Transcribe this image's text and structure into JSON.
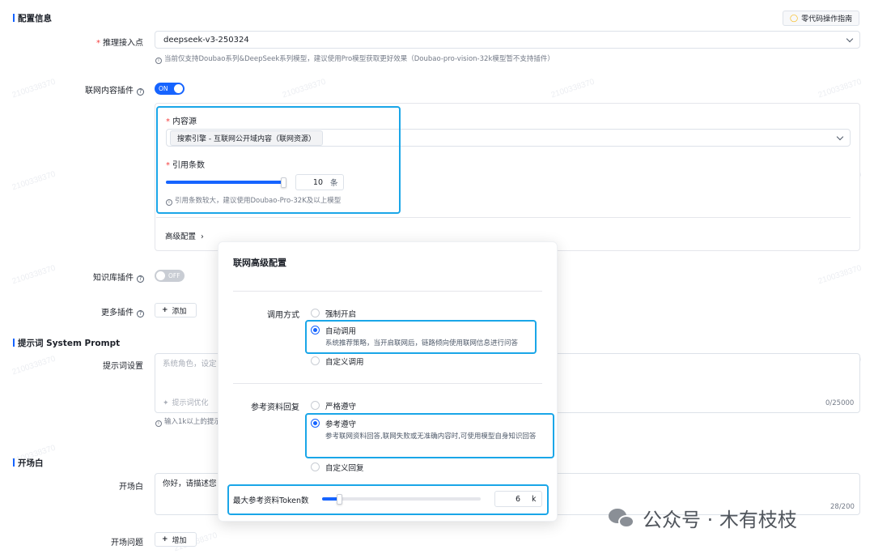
{
  "watermark": "2100338370",
  "config_section": {
    "title": "配置信息",
    "guide_button": "零代码操作指南",
    "endpoint": {
      "label": "推理接入点",
      "value": "deepseek-v3-250324",
      "hint": "当前仅支持Doubao系列&DeepSeek系列模型，建议使用Pro模型获取更好效果（Doubao-pro-vision-32k模型暂不支持插件）"
    },
    "web_plugin": {
      "label": "联网内容插件",
      "toggle": "ON",
      "source_label": "内容源",
      "source_tag": "搜索引擎 - 互联网公开域内容（联网资源）",
      "cite_label": "引用条数",
      "cite_value": "10",
      "cite_unit": "条",
      "cite_level": 1.0,
      "cite_hint": "引用条数较大，建议使用Doubao-Pro-32K及以上模型",
      "advanced": "高级配置"
    },
    "kb_plugin": {
      "label": "知识库插件",
      "toggle": "OFF"
    },
    "more_plugins": {
      "label": "更多插件",
      "button": "添加"
    }
  },
  "prompt_section": {
    "title": "提示词 System Prompt",
    "label": "提示词设置",
    "placeholder": "系统角色，设定",
    "optimize": "提示词优化",
    "counter": "0/25000",
    "hint": "输入1k以上的提示"
  },
  "opening_section": {
    "title": "开场白",
    "label": "开场白",
    "value": "你好，请描述您",
    "counter": "28/200",
    "question_label": "开场问题",
    "question_button": "增加"
  },
  "modal": {
    "title": "联网高级配置",
    "call_mode": {
      "label": "调用方式",
      "options": [
        {
          "label": "强制开启",
          "checked": false,
          "desc": ""
        },
        {
          "label": "自动调用",
          "checked": true,
          "desc": "系统推荐策略，当开启联网后，链路倾向使用联网信息进行问答"
        },
        {
          "label": "自定义调用",
          "checked": false,
          "desc": ""
        }
      ]
    },
    "reference": {
      "label": "参考资料回复",
      "options": [
        {
          "label": "严格遵守",
          "checked": false,
          "desc": ""
        },
        {
          "label": "参考遵守",
          "checked": true,
          "desc": "参考联网资料回答,联网失败或无准确内容时,可使用模型自身知识回答"
        },
        {
          "label": "自定义回复",
          "checked": false,
          "desc": ""
        }
      ]
    },
    "max_tokens": {
      "label": "最大参考资料Token数",
      "value": "6",
      "unit": "k",
      "level": 0.11
    }
  },
  "brand_overlay": "公众号 · 木有枝枝",
  "colors": {
    "accent": "#1664ff",
    "highlight": "#1aa6e8",
    "required": "#f53f3f"
  }
}
